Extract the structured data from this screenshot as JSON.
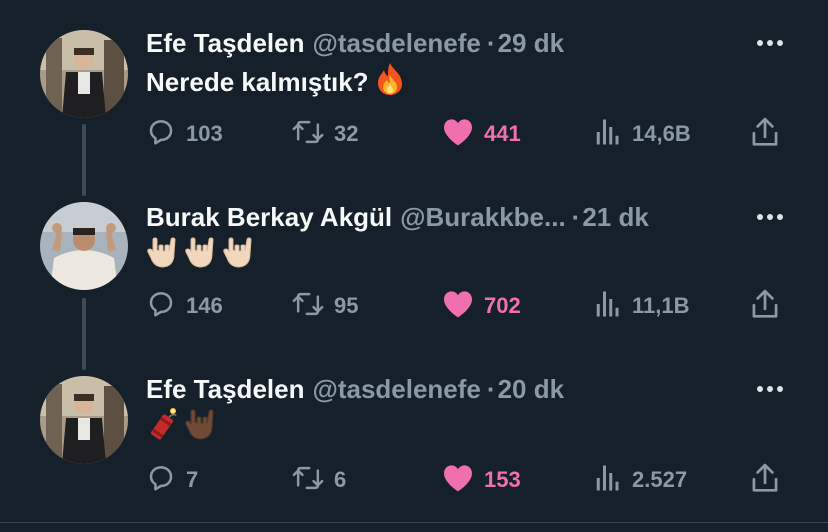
{
  "tweets": [
    {
      "name": "Efe Taşdelen",
      "handle": "@tasdelenefe",
      "separator": "·",
      "time": "29 dk",
      "text": "Nerede kalmıştık?",
      "emoji": [
        "fire-icon"
      ],
      "replies": "103",
      "retweets": "32",
      "likes": "441",
      "views": "14,6B"
    },
    {
      "name": "Burak Berkay Akgül",
      "handle": "@Burakkbe...",
      "separator": "·",
      "time": "21 dk",
      "text": "",
      "emoji": [
        "rock-hand-icon",
        "rock-hand-icon",
        "rock-hand-icon"
      ],
      "replies": "146",
      "retweets": "95",
      "likes": "702",
      "views": "11,1B"
    },
    {
      "name": "Efe Taşdelen",
      "handle": "@tasdelenefe",
      "separator": "·",
      "time": "20 dk",
      "text": "",
      "emoji": [
        "firecracker-icon",
        "rock-hand-dark-icon"
      ],
      "replies": "7",
      "retweets": "6",
      "likes": "153",
      "views": "2.527"
    }
  ],
  "colors": {
    "background": "#15202b",
    "text": "#f7f9f9",
    "muted": "#8b98a5",
    "like": "#f91880",
    "thread_line": "#3d4a57"
  }
}
